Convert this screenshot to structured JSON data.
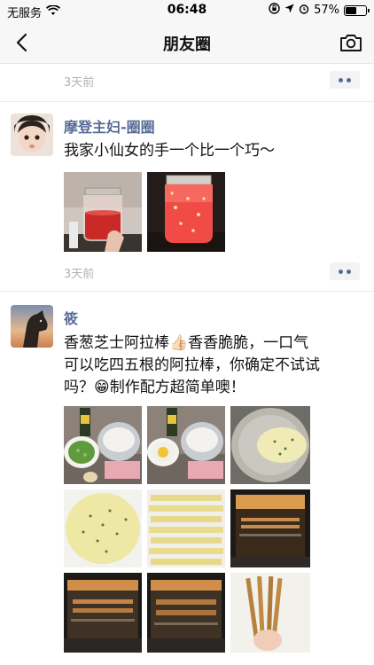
{
  "status": {
    "carrier": "无服务",
    "time": "06:48",
    "battery": "57%",
    "battery_level": 0.57
  },
  "nav": {
    "title": "朋友圈"
  },
  "top_post": {
    "time": "3天前"
  },
  "posts": [
    {
      "author": "摩登主妇-圈圈",
      "text": "我家小仙女的手一个比一个巧～",
      "time": "3天前"
    },
    {
      "author": "筱",
      "text_line1": "香葱芝士阿拉棒👍🏻香香脆脆，一口气",
      "text_line2": "可以吃四五根的阿拉棒，你确定不试试",
      "text_line3": "吗？😁制作配方超简单噢！"
    }
  ]
}
